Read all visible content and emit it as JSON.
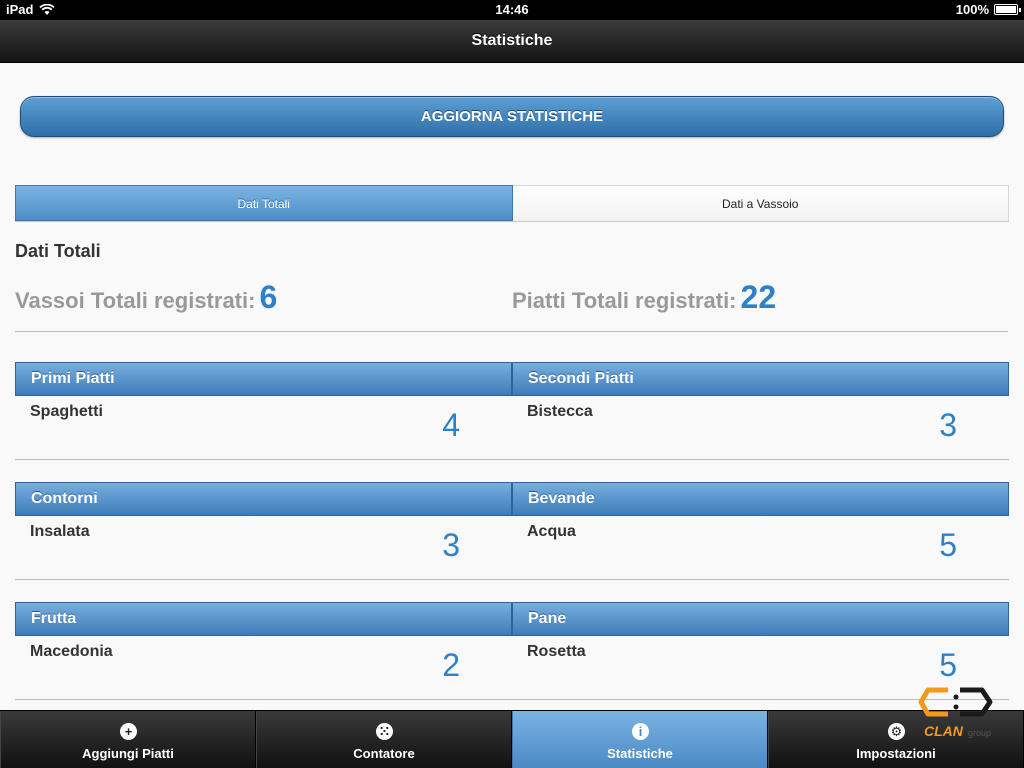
{
  "status_bar": {
    "device": "iPad",
    "time": "14:46",
    "battery": "100%"
  },
  "nav": {
    "title": "Statistiche"
  },
  "refresh_button": {
    "label": "AGGIORNA STATISTICHE"
  },
  "segments": [
    {
      "label": "Dati Totali",
      "active": true
    },
    {
      "label": "Dati a Vassoio",
      "active": false
    }
  ],
  "section_title": "Dati Totali",
  "totals": {
    "vassoi_label": "Vassoi Totali registrati:",
    "vassoi_value": "6",
    "piatti_label": "Piatti Totali registrati:",
    "piatti_value": "22"
  },
  "categories": [
    {
      "name": "Primi Piatti",
      "item": "Spaghetti",
      "count": "4"
    },
    {
      "name": "Secondi Piatti",
      "item": "Bistecca",
      "count": "3"
    },
    {
      "name": "Contorni",
      "item": "Insalata",
      "count": "3"
    },
    {
      "name": "Bevande",
      "item": "Acqua",
      "count": "5"
    },
    {
      "name": "Frutta",
      "item": "Macedonia",
      "count": "2"
    },
    {
      "name": "Pane",
      "item": "Rosetta",
      "count": "5"
    }
  ],
  "tabs": [
    {
      "label": "Aggiungi Piatti",
      "icon": "+"
    },
    {
      "label": "Contatore",
      "icon": "⁙"
    },
    {
      "label": "Statistiche",
      "icon": "i"
    },
    {
      "label": "Impostazioni",
      "icon": "⚙"
    }
  ],
  "logo": {
    "text": "CLAN",
    "suffix": "group"
  },
  "colors": {
    "accent": "#2d82c7",
    "header_blue": "#4f8dc7",
    "logo_orange": "#f39a1e"
  }
}
